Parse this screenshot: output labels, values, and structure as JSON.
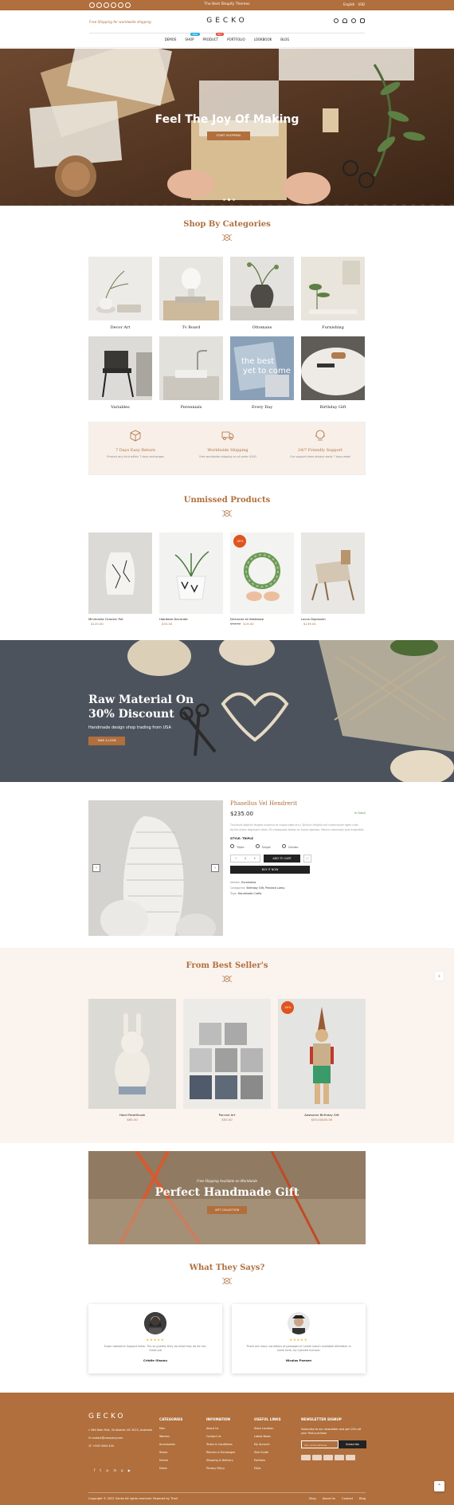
{
  "topbar": {
    "promo": "The Best Shopify Themes",
    "language": "English",
    "currency": "USD"
  },
  "header": {
    "ship_note": "Free Shipping for worldwide shipping",
    "logo": "GECKO",
    "nav": [
      {
        "label": "DEMOS",
        "badge": ""
      },
      {
        "label": "SHOP",
        "badge": "NEW",
        "badge_color": "#27a9e1"
      },
      {
        "label": "PRODUCT",
        "badge": "HOT",
        "badge_color": "#e24d3d"
      },
      {
        "label": "PORTFOLIO",
        "badge": ""
      },
      {
        "label": "LOOKBOOK",
        "badge": ""
      },
      {
        "label": "BLOG",
        "badge": ""
      }
    ]
  },
  "hero": {
    "title": "Feel The Joy Of Making",
    "button": "START SHOPPING"
  },
  "categories": {
    "title": "Shop By Categories",
    "items": [
      {
        "label": "Decor Art"
      },
      {
        "label": "Tv Board"
      },
      {
        "label": "Ottomans"
      },
      {
        "label": "Furnishing"
      },
      {
        "label": "Variables"
      },
      {
        "label": "Perennials"
      },
      {
        "label": "Every Day"
      },
      {
        "label": "Birthday Gift"
      }
    ]
  },
  "features": [
    {
      "icon": "box-icon",
      "title": "7 Days Easy Return",
      "desc": "Product any kind within 7 days exchanges"
    },
    {
      "icon": "truck-icon",
      "title": "Worldwide Shipping",
      "desc": "Free worldwide shipping on all order $100"
    },
    {
      "icon": "support-icon",
      "title": "24/7 Friendly Support",
      "desc": "Our support team always ready 7 days week"
    }
  ],
  "unmissed": {
    "title": "Unmissed Products",
    "items": [
      {
        "name": "Minimalist Ceramic Pot",
        "price": "$120.00",
        "old_price": "",
        "sale": ""
      },
      {
        "name": "Habitaee Decorate",
        "price": "$35.00",
        "old_price": "",
        "sale": ""
      },
      {
        "name": "Dictumst at Habitasse",
        "price": "$19.00",
        "old_price": "$50.00",
        "sale": "-40%"
      },
      {
        "name": "Lacus Dignissim",
        "price": "$139.00",
        "old_price": "",
        "sale": ""
      }
    ]
  },
  "promo_banner": {
    "line1": "Raw Material On",
    "line2": "30% Discount",
    "subtitle": "Handmade design shop trading from USA",
    "button": "TAKE A LOOK"
  },
  "product_detail": {
    "name": "Phasellus Vel Hendrerit",
    "stock": "In Stock",
    "price": "$235.00",
    "description": "Tincidunt lobortis feugiat vivamus at augue eget arcu. Dictum fringilla est ullamcorper eget nulla facilisi etiam dignissim diam. Et malesuada fames ac turpis egestas. Mauris commodo quis imperdiet.",
    "style_label": "STYLE: TRIPLE",
    "styles": [
      "Triple",
      "Single",
      "Combo"
    ],
    "qty": "1",
    "add_to_cart": "ADD TO CART",
    "buy_now": "BUY IT NOW",
    "vendor_label": "Vendor:",
    "vendor": "Euromotos",
    "categories_label": "Categories:",
    "categories": "Birthday Gift, Pendant Lamp",
    "tags_label": "Tags:",
    "tags": "Handmade Crafts"
  },
  "best_seller": {
    "title": "From Best Seller's",
    "items": [
      {
        "name": "Hand Paratifcook",
        "price": "$65.00",
        "old_price": "",
        "sale": ""
      },
      {
        "name": "Porcine Art",
        "price": "$50.00",
        "old_price": "",
        "sale": ""
      },
      {
        "name": "Awesome Birthday Gift",
        "price": "$30.00",
        "old_price": "$55.00",
        "sale": "-50%"
      }
    ]
  },
  "gift_banner": {
    "small": "Free Shipping Available on Worldwide",
    "big": "Perfect Handmade Gift",
    "button": "GIFT COLLECTION"
  },
  "testimonials": {
    "title": "What They Says?",
    "stars": "★★★★★",
    "items": [
      {
        "quote": "Super awesome Support team. Thx so guidely they do what they do for me. Great job",
        "name": "Cristie Olsonu"
      },
      {
        "quote": "There are many variations of passages of Lorem Ipsum available alteration in some form, by injected humour.",
        "name": "Nicolas Poesen"
      }
    ]
  },
  "footer": {
    "logo": "GECKO",
    "address": "264 Main Port, 30 Alberta VIC 3023, Australia",
    "email": "contact@company.com",
    "phone": "+000 0000 400",
    "columns": [
      {
        "heading": "CATEGORIES",
        "links": [
          "Men",
          "Women",
          "Accessories",
          "Shoes",
          "Denim",
          "Dress"
        ]
      },
      {
        "heading": "INFOMATION",
        "links": [
          "About Us",
          "Contact Us",
          "Terms & Conditions",
          "Returns & Exchanges",
          "Shipping & Delivery",
          "Privacy Policy"
        ]
      },
      {
        "heading": "USEFUL LINKS",
        "links": [
          "Store Location",
          "Latest News",
          "My Account",
          "Size Guide",
          "Portfolio",
          "FAQs"
        ]
      }
    ],
    "newsletter_heading": "NEWSLETTER SIGNUP",
    "newsletter_desc": "Subscribe to our newsletter and get 10% off your first purchase",
    "newsletter_placeholder": "Your email address",
    "subscribe": "Subscribe",
    "copyright": "Copyright © 2022 Gecko All rights reserved. Powered by The4",
    "bottom_links": [
      "Shop",
      "About Us",
      "Contact",
      "Blog"
    ]
  },
  "colors": {
    "accent": "#b06f3c",
    "sale": "#e0531f",
    "light_bg": "#fbf3ee"
  }
}
